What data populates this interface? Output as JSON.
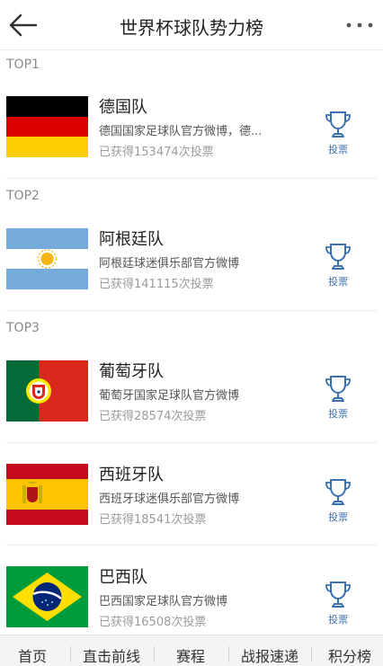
{
  "header": {
    "title": "世界杯球队势力榜"
  },
  "sections": {
    "top1": "TOP1",
    "top2": "TOP2",
    "top3": "TOP3"
  },
  "teams": [
    {
      "name": "德国队",
      "desc": "德国国家足球队官方微博，德...",
      "votes": "已获得153474次投票",
      "flag": "germany",
      "vote_label": "投票"
    },
    {
      "name": "阿根廷队",
      "desc": "阿根廷球迷俱乐部官方微博",
      "votes": "已获得141115次投票",
      "flag": "argentina",
      "vote_label": "投票"
    },
    {
      "name": "葡萄牙队",
      "desc": "葡萄牙国家足球队官方微博",
      "votes": "已获得28574次投票",
      "flag": "portugal",
      "vote_label": "投票"
    },
    {
      "name": "西班牙队",
      "desc": "西班牙球迷俱乐部官方微博",
      "votes": "已获得18541次投票",
      "flag": "spain",
      "vote_label": "投票"
    },
    {
      "name": "巴西队",
      "desc": "巴西国家足球队官方微博",
      "votes": "已获得16508次投票",
      "flag": "brazil",
      "vote_label": "投票"
    }
  ],
  "tabbar": [
    "首页",
    "直击前线",
    "赛程",
    "战报速递",
    "积分榜"
  ],
  "colors": {
    "vote_blue": "#3a6fb0",
    "muted": "#9b9b9b"
  }
}
